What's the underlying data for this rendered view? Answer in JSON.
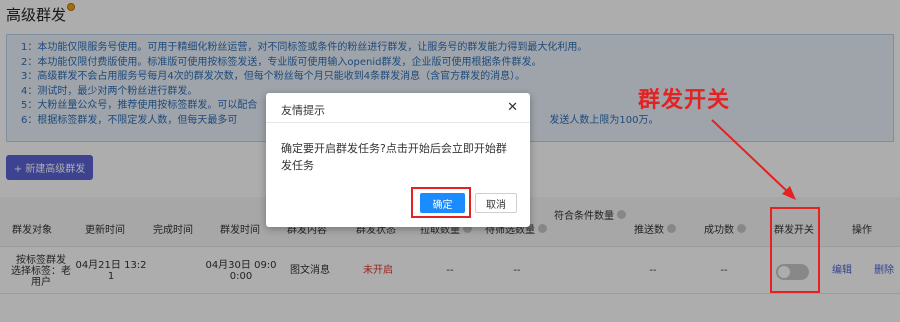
{
  "page": {
    "title": "高级群发"
  },
  "notice": {
    "lines": [
      "1：本功能仅限服务号使用。可用于精细化粉丝运营，对不同标签或条件的粉丝进行群发，让服务号的群发能力得到最大化利用。",
      "2：本功能仅限付费版使用。标准版可使用按标签发送，专业版可使用输入openid群发，企业版可使用根据条件群发。",
      "3：高级群发不会占用服务号每月4次的群发次数，但每个粉丝每个月只能收到4条群发消息（含官方群发的消息）。",
      "4：测试时，最少对两个粉丝进行群发。",
      "5：大粉丝量公众号，推荐使用按标签群发。可以配合",
      "6：根据标签群发，不限定发人数，但每天最多可"
    ],
    "line6_tail": "发送人数上限为100万。"
  },
  "toolbar": {
    "new_button": "+ 新建高级群发"
  },
  "table": {
    "headers": {
      "target": "群发对象",
      "update_time": "更新时间",
      "done_time": "完成时间",
      "send_time": "群发时间",
      "content": "群发内容",
      "status": "群发状态",
      "matched_group": "符合条件数量",
      "pulled": "拉取数量",
      "pending": "待筛选数量",
      "sent": "推送数",
      "success": "成功数",
      "switch": "群发开关",
      "actions": "操作"
    },
    "row": {
      "target_line1": "按标签群发",
      "target_line2": "选择标签：老",
      "target_line3": "用户",
      "update_line1": "04月21日 13:2",
      "update_line2": "1",
      "send_line1": "04月30日 09:0",
      "send_line2": "0:00",
      "content": "图文消息",
      "status": "未开启",
      "pulled": "--",
      "pending": "--",
      "sent": "--",
      "success": "--",
      "switch_on": false,
      "edit": "编辑",
      "delete": "删除"
    }
  },
  "modal": {
    "title": "友情提示",
    "close": "✕",
    "message": "确定要开启群发任务?点击开始后会立即开始群发任务",
    "ok": "确定",
    "cancel": "取消"
  },
  "annotation": {
    "label": "群发开关"
  },
  "colors": {
    "accent": "#5b62d6",
    "primary_button": "#1a8cff",
    "annotation": "#e32222",
    "status_off": "#e0362d"
  }
}
